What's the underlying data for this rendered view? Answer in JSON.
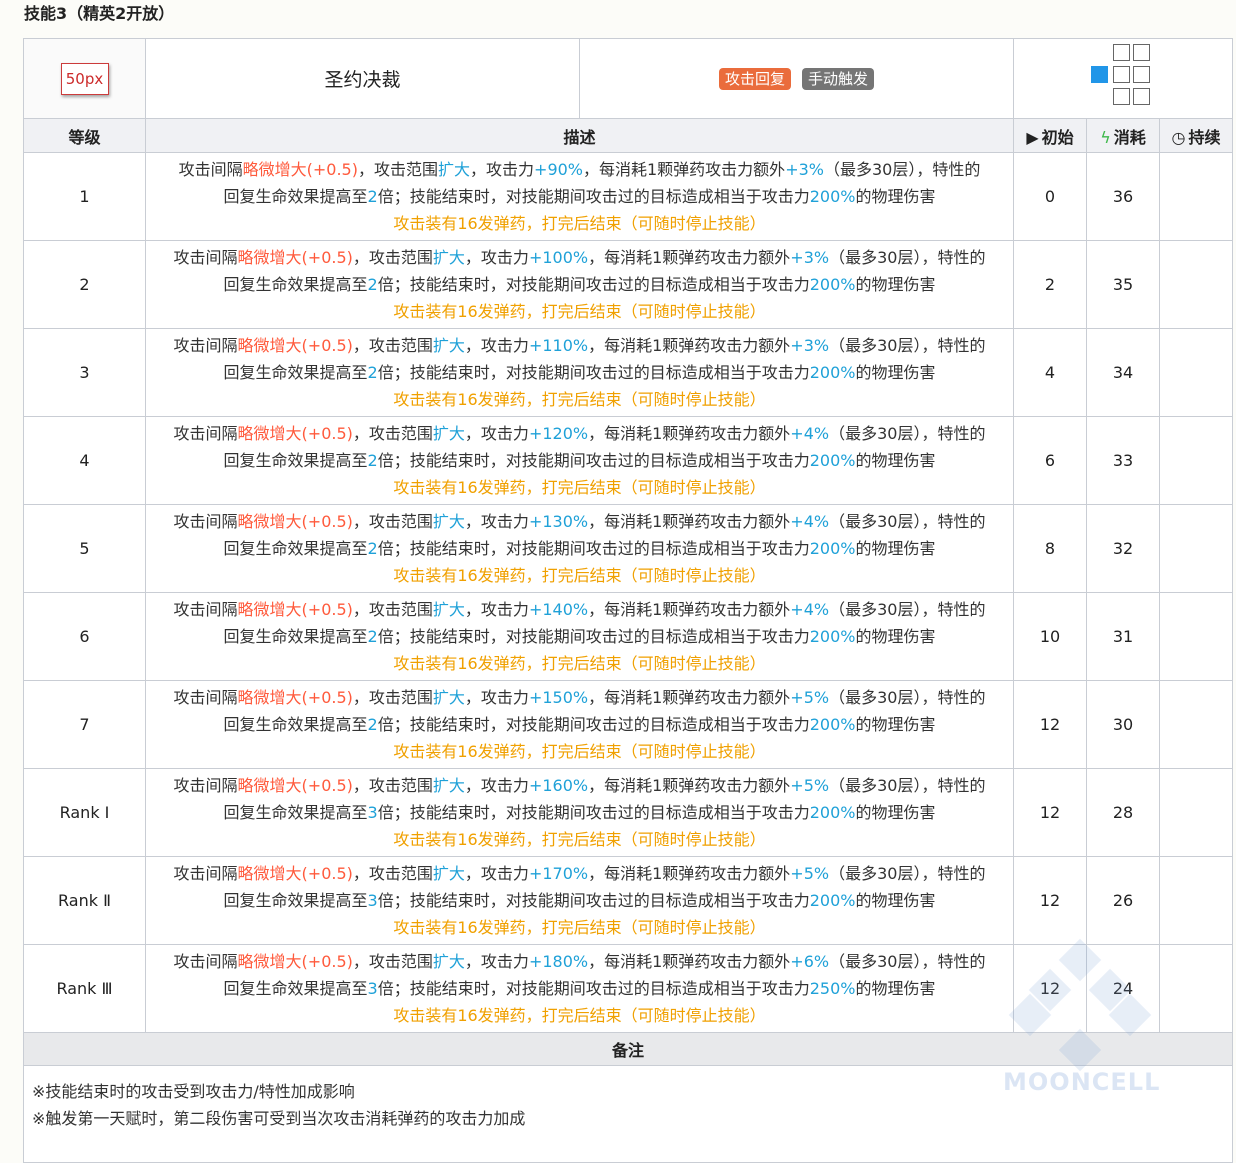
{
  "section_title": "技能3（精英2开放）",
  "skill": {
    "icon_label": "50px",
    "name": "圣约决裁",
    "tags": [
      "攻击回复",
      "手动触发"
    ],
    "range_icon": "range-grid-icon"
  },
  "columns": {
    "level": "等级",
    "description": "描述",
    "initial": "初始",
    "cost": "消耗",
    "duration": "持续"
  },
  "rows": [
    {
      "level": "1",
      "l1_pre": "攻击间隔",
      "l1_red": "略微增大(+0.5)",
      "l1_mid": "，攻击范围",
      "l1_blue": "扩大",
      "l1_atk_pre": "，攻击力",
      "l1_atk": "+90%",
      "l1_post": "，每消耗1颗弹药攻击力额外",
      "l1_bonus": "+3%",
      "l1_end": "（最多30层），特性的",
      "l2_pre": "回复生命效果提高至",
      "l2_mult": "2",
      "l2_mid": "倍；技能结束时，对技能期间攻击过的目标造成相当于攻击力",
      "l2_dmg": "200%",
      "l2_end": "的物理伤害",
      "l3": "攻击装有16发弹药，打完后结束（可随时停止技能）",
      "initial": "0",
      "cost": "36",
      "duration": ""
    },
    {
      "level": "2",
      "l1_pre": "攻击间隔",
      "l1_red": "略微增大(+0.5)",
      "l1_mid": "，攻击范围",
      "l1_blue": "扩大",
      "l1_atk_pre": "，攻击力",
      "l1_atk": "+100%",
      "l1_post": "，每消耗1颗弹药攻击力额外",
      "l1_bonus": "+3%",
      "l1_end": "（最多30层），特性的",
      "l2_pre": "回复生命效果提高至",
      "l2_mult": "2",
      "l2_mid": "倍；技能结束时，对技能期间攻击过的目标造成相当于攻击力",
      "l2_dmg": "200%",
      "l2_end": "的物理伤害",
      "l3": "攻击装有16发弹药，打完后结束（可随时停止技能）",
      "initial": "2",
      "cost": "35",
      "duration": ""
    },
    {
      "level": "3",
      "l1_pre": "攻击间隔",
      "l1_red": "略微增大(+0.5)",
      "l1_mid": "，攻击范围",
      "l1_blue": "扩大",
      "l1_atk_pre": "，攻击力",
      "l1_atk": "+110%",
      "l1_post": "，每消耗1颗弹药攻击力额外",
      "l1_bonus": "+3%",
      "l1_end": "（最多30层），特性的",
      "l2_pre": "回复生命效果提高至",
      "l2_mult": "2",
      "l2_mid": "倍；技能结束时，对技能期间攻击过的目标造成相当于攻击力",
      "l2_dmg": "200%",
      "l2_end": "的物理伤害",
      "l3": "攻击装有16发弹药，打完后结束（可随时停止技能）",
      "initial": "4",
      "cost": "34",
      "duration": ""
    },
    {
      "level": "4",
      "l1_pre": "攻击间隔",
      "l1_red": "略微增大(+0.5)",
      "l1_mid": "，攻击范围",
      "l1_blue": "扩大",
      "l1_atk_pre": "，攻击力",
      "l1_atk": "+120%",
      "l1_post": "，每消耗1颗弹药攻击力额外",
      "l1_bonus": "+4%",
      "l1_end": "（最多30层），特性的",
      "l2_pre": "回复生命效果提高至",
      "l2_mult": "2",
      "l2_mid": "倍；技能结束时，对技能期间攻击过的目标造成相当于攻击力",
      "l2_dmg": "200%",
      "l2_end": "的物理伤害",
      "l3": "攻击装有16发弹药，打完后结束（可随时停止技能）",
      "initial": "6",
      "cost": "33",
      "duration": ""
    },
    {
      "level": "5",
      "l1_pre": "攻击间隔",
      "l1_red": "略微增大(+0.5)",
      "l1_mid": "，攻击范围",
      "l1_blue": "扩大",
      "l1_atk_pre": "，攻击力",
      "l1_atk": "+130%",
      "l1_post": "，每消耗1颗弹药攻击力额外",
      "l1_bonus": "+4%",
      "l1_end": "（最多30层），特性的",
      "l2_pre": "回复生命效果提高至",
      "l2_mult": "2",
      "l2_mid": "倍；技能结束时，对技能期间攻击过的目标造成相当于攻击力",
      "l2_dmg": "200%",
      "l2_end": "的物理伤害",
      "l3": "攻击装有16发弹药，打完后结束（可随时停止技能）",
      "initial": "8",
      "cost": "32",
      "duration": ""
    },
    {
      "level": "6",
      "l1_pre": "攻击间隔",
      "l1_red": "略微增大(+0.5)",
      "l1_mid": "，攻击范围",
      "l1_blue": "扩大",
      "l1_atk_pre": "，攻击力",
      "l1_atk": "+140%",
      "l1_post": "，每消耗1颗弹药攻击力额外",
      "l1_bonus": "+4%",
      "l1_end": "（最多30层），特性的",
      "l2_pre": "回复生命效果提高至",
      "l2_mult": "2",
      "l2_mid": "倍；技能结束时，对技能期间攻击过的目标造成相当于攻击力",
      "l2_dmg": "200%",
      "l2_end": "的物理伤害",
      "l3": "攻击装有16发弹药，打完后结束（可随时停止技能）",
      "initial": "10",
      "cost": "31",
      "duration": ""
    },
    {
      "level": "7",
      "l1_pre": "攻击间隔",
      "l1_red": "略微增大(+0.5)",
      "l1_mid": "，攻击范围",
      "l1_blue": "扩大",
      "l1_atk_pre": "，攻击力",
      "l1_atk": "+150%",
      "l1_post": "，每消耗1颗弹药攻击力额外",
      "l1_bonus": "+5%",
      "l1_end": "（最多30层），特性的",
      "l2_pre": "回复生命效果提高至",
      "l2_mult": "2",
      "l2_mid": "倍；技能结束时，对技能期间攻击过的目标造成相当于攻击力",
      "l2_dmg": "200%",
      "l2_end": "的物理伤害",
      "l3": "攻击装有16发弹药，打完后结束（可随时停止技能）",
      "initial": "12",
      "cost": "30",
      "duration": ""
    },
    {
      "level": "Rank Ⅰ",
      "l1_pre": "攻击间隔",
      "l1_red": "略微增大(+0.5)",
      "l1_mid": "，攻击范围",
      "l1_blue": "扩大",
      "l1_atk_pre": "，攻击力",
      "l1_atk": "+160%",
      "l1_post": "，每消耗1颗弹药攻击力额外",
      "l1_bonus": "+5%",
      "l1_end": "（最多30层），特性的",
      "l2_pre": "回复生命效果提高至",
      "l2_mult": "3",
      "l2_mid": "倍；技能结束时，对技能期间攻击过的目标造成相当于攻击力",
      "l2_dmg": "200%",
      "l2_end": "的物理伤害",
      "l3": "攻击装有16发弹药，打完后结束（可随时停止技能）",
      "initial": "12",
      "cost": "28",
      "duration": ""
    },
    {
      "level": "Rank Ⅱ",
      "l1_pre": "攻击间隔",
      "l1_red": "略微增大(+0.5)",
      "l1_mid": "，攻击范围",
      "l1_blue": "扩大",
      "l1_atk_pre": "，攻击力",
      "l1_atk": "+170%",
      "l1_post": "，每消耗1颗弹药攻击力额外",
      "l1_bonus": "+5%",
      "l1_end": "（最多30层），特性的",
      "l2_pre": "回复生命效果提高至",
      "l2_mult": "3",
      "l2_mid": "倍；技能结束时，对技能期间攻击过的目标造成相当于攻击力",
      "l2_dmg": "200%",
      "l2_end": "的物理伤害",
      "l3": "攻击装有16发弹药，打完后结束（可随时停止技能）",
      "initial": "12",
      "cost": "26",
      "duration": ""
    },
    {
      "level": "Rank Ⅲ",
      "l1_pre": "攻击间隔",
      "l1_red": "略微增大(+0.5)",
      "l1_mid": "，攻击范围",
      "l1_blue": "扩大",
      "l1_atk_pre": "，攻击力",
      "l1_atk": "+180%",
      "l1_post": "，每消耗1颗弹药攻击力额外",
      "l1_bonus": "+6%",
      "l1_end": "（最多30层），特性的",
      "l2_pre": "回复生命效果提高至",
      "l2_mult": "3",
      "l2_mid": "倍；技能结束时，对技能期间攻击过的目标造成相当于攻击力",
      "l2_dmg": "250%",
      "l2_end": "的物理伤害",
      "l3": "攻击装有16发弹药，打完后结束（可随时停止技能）",
      "initial": "12",
      "cost": "24",
      "duration": ""
    }
  ],
  "notes": {
    "title": "备注",
    "lines": [
      "※技能结束时的攻击受到攻击力/特性加成影响",
      "※触发第一天赋时，第二段伤害可受到当次攻击消耗弹药的攻击力加成"
    ]
  },
  "watermark": "MOONCELL",
  "colors": {
    "highlight_red": "#ff5a3c",
    "highlight_blue": "#1fa1d8",
    "highlight_orange": "#f0a000",
    "tag_orange": "#ea6c3c",
    "tag_gray": "#757575",
    "range_self": "#2196e8",
    "header_bg": "#f0f1f4"
  }
}
